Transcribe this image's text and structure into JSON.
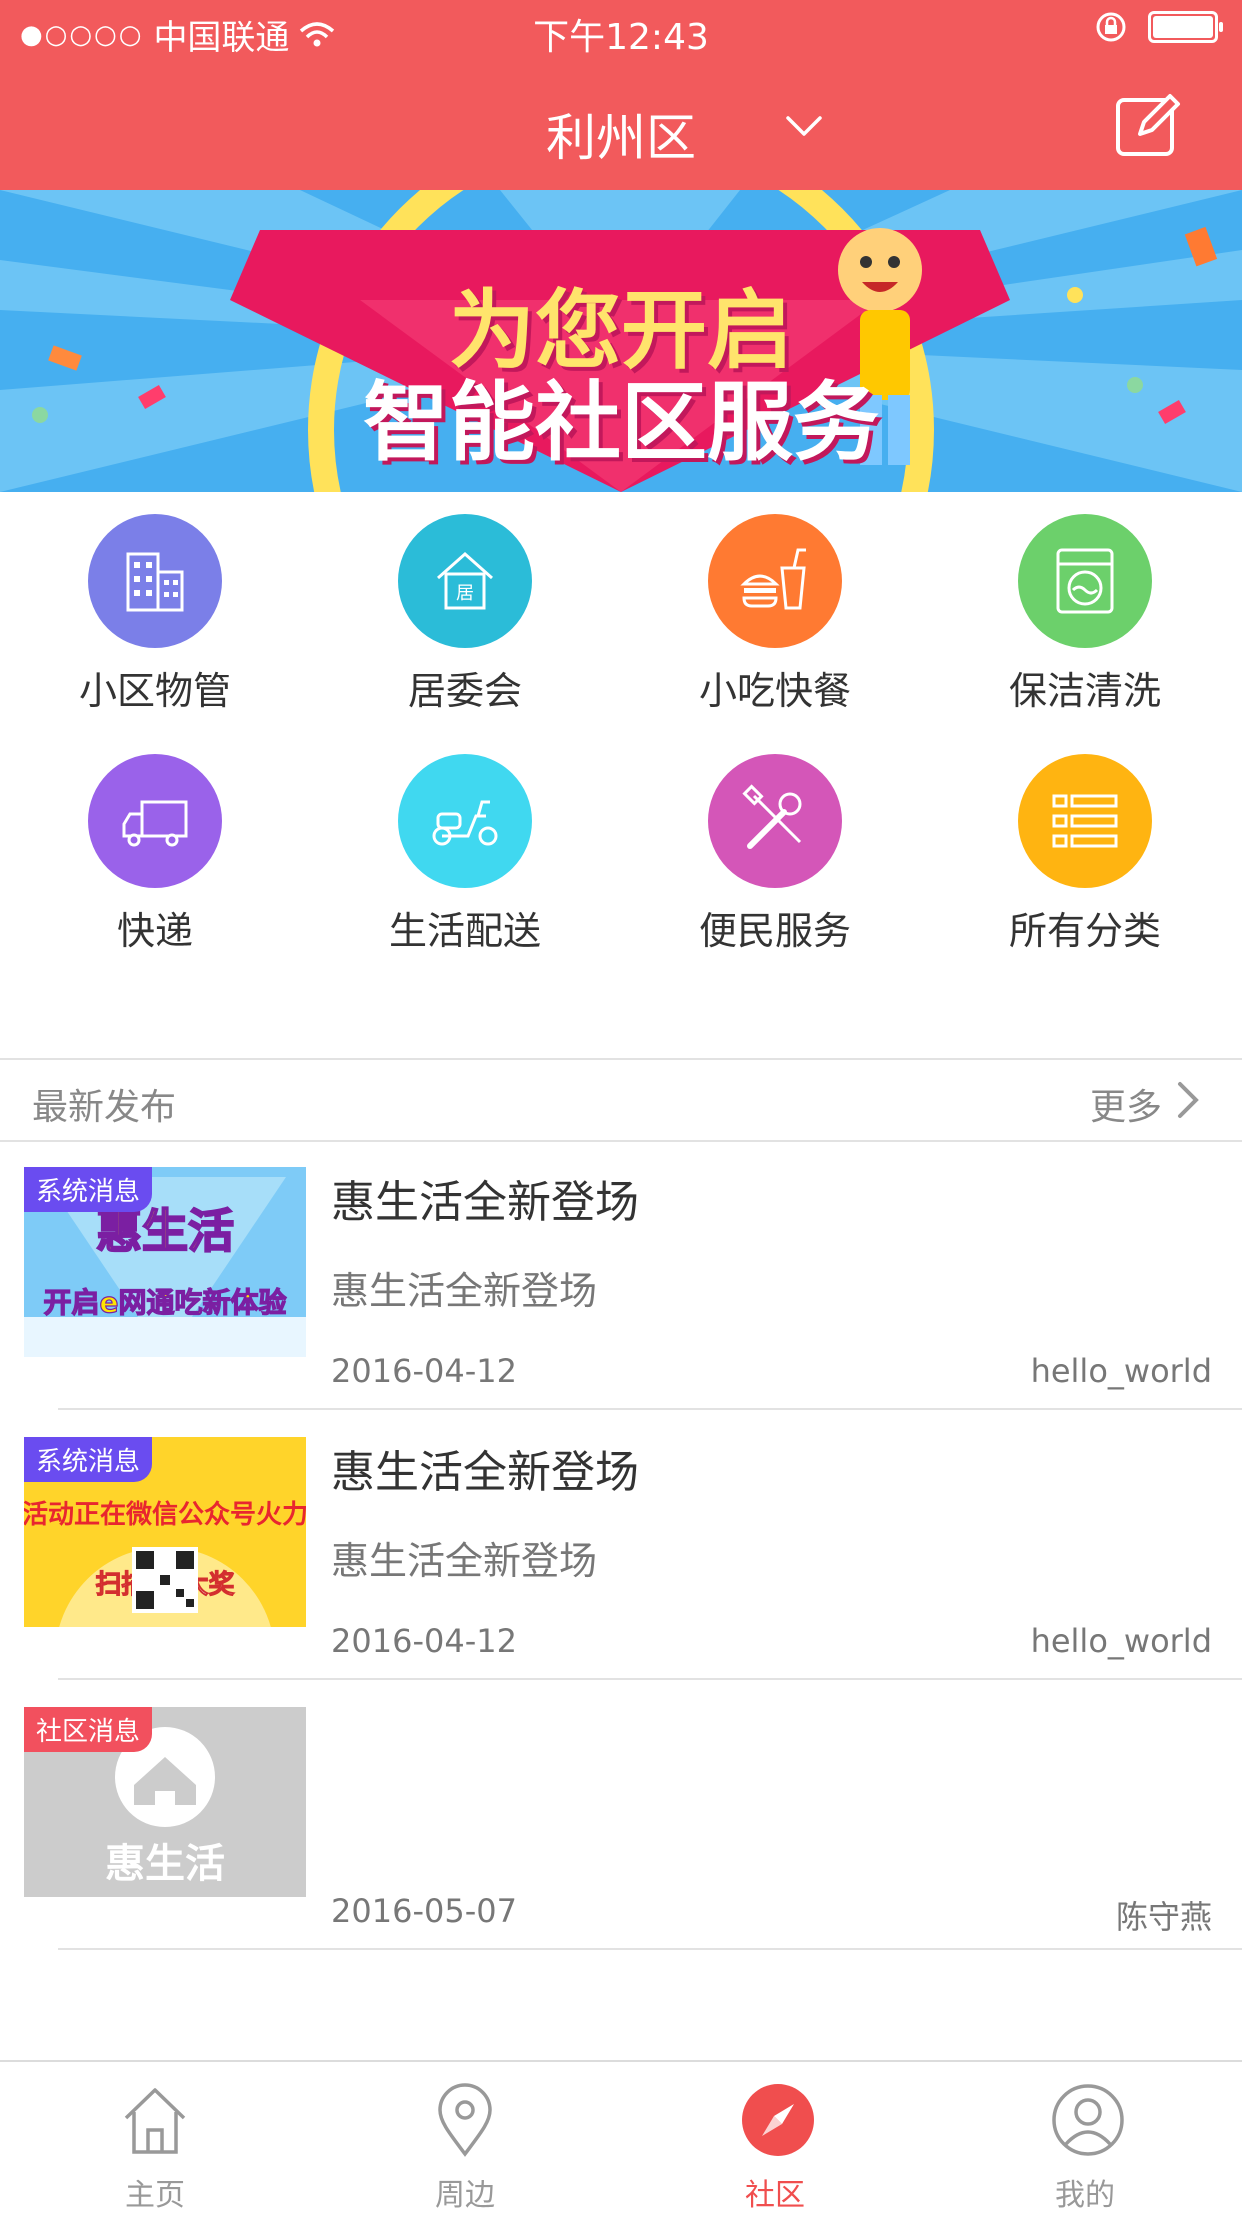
{
  "status_bar": {
    "signal_dots": "●○○○○",
    "carrier": "中国联通",
    "time": "下午12:43"
  },
  "header": {
    "title": "利州区"
  },
  "banner": {
    "line1": "为您开启",
    "line2": "智能社区服务"
  },
  "categories": [
    {
      "label": "小区物管",
      "icon": "building-icon",
      "color": "#7b7fe8"
    },
    {
      "label": "居委会",
      "icon": "house-icon",
      "color": "#2bbcd8"
    },
    {
      "label": "小吃快餐",
      "icon": "fast-food-icon",
      "color": "#ff7a32"
    },
    {
      "label": "保洁清洗",
      "icon": "washing-machine-icon",
      "color": "#6cd06b"
    },
    {
      "label": "快递",
      "icon": "truck-icon",
      "color": "#9a62ea"
    },
    {
      "label": "生活配送",
      "icon": "scooter-icon",
      "color": "#40d8f0"
    },
    {
      "label": "便民服务",
      "icon": "tools-icon",
      "color": "#d456b8"
    },
    {
      "label": "所有分类",
      "icon": "list-icon",
      "color": "#ffb411"
    }
  ],
  "latest": {
    "title": "最新发布",
    "more": "更多",
    "items": [
      {
        "tag": "系统消息",
        "title": "惠生活全新登场",
        "subtitle": "惠生活全新登场",
        "date": "2016-04-12",
        "author": "hello_world",
        "thumb_text1": "惠生活",
        "thumb_text2": "开启e网通吃新体验"
      },
      {
        "tag": "系统消息",
        "title": "惠生活全新登场",
        "subtitle": "惠生活全新登场",
        "date": "2016-04-12",
        "author": "hello_world",
        "thumb_text1": "活动正在微信公众号火力",
        "thumb_text2": "扫描    赢大奖"
      },
      {
        "tag": "社区消息",
        "title": "",
        "subtitle": "",
        "date": "2016-05-07",
        "author": "陈守燕",
        "thumb_text1": "惠生活",
        "thumb_text2": ""
      }
    ]
  },
  "tabbar": [
    {
      "label": "主页",
      "icon": "home-icon"
    },
    {
      "label": "周边",
      "icon": "location-pin-icon"
    },
    {
      "label": "社区",
      "icon": "compass-icon",
      "active": true
    },
    {
      "label": "我的",
      "icon": "user-icon"
    }
  ],
  "colors": {
    "brand": "#f25a5c",
    "tag_system": "#6a4cf0",
    "tag_community": "#f2505e",
    "tab_active": "#f04e4e"
  }
}
